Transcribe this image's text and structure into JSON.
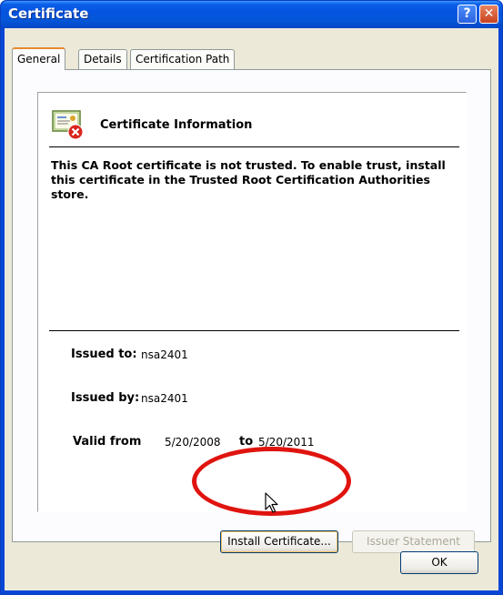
{
  "window": {
    "title": "Certificate",
    "help_glyph": "?",
    "close_glyph": "✕"
  },
  "tabs": [
    {
      "label": "General",
      "selected": true
    },
    {
      "label": "Details",
      "selected": false
    },
    {
      "label": "Certification Path",
      "selected": false
    }
  ],
  "general": {
    "heading": "Certificate Information",
    "trust_warning": "This CA Root certificate is not trusted. To enable trust, install this certificate in the Trusted Root Certification Authorities store.",
    "issued_to_label": "Issued to:",
    "issued_to_value": "nsa2401",
    "issued_by_label": "Issued by:",
    "issued_by_value": "nsa2401",
    "valid_from_label": "Valid from",
    "valid_from_value": "5/20/2008",
    "valid_to_label": "to",
    "valid_to_value": "5/20/2011"
  },
  "buttons": {
    "install_certificate": "Install Certificate...",
    "issuer_statement": "Issuer Statement",
    "ok": "OK"
  },
  "icons": {
    "certificate": "certificate-error-icon",
    "cursor": "mouse-pointer-icon"
  },
  "colors": {
    "highlight": "#e0140f",
    "titlebar": "#0553e0",
    "dialog_bg": "#ece9d8"
  }
}
